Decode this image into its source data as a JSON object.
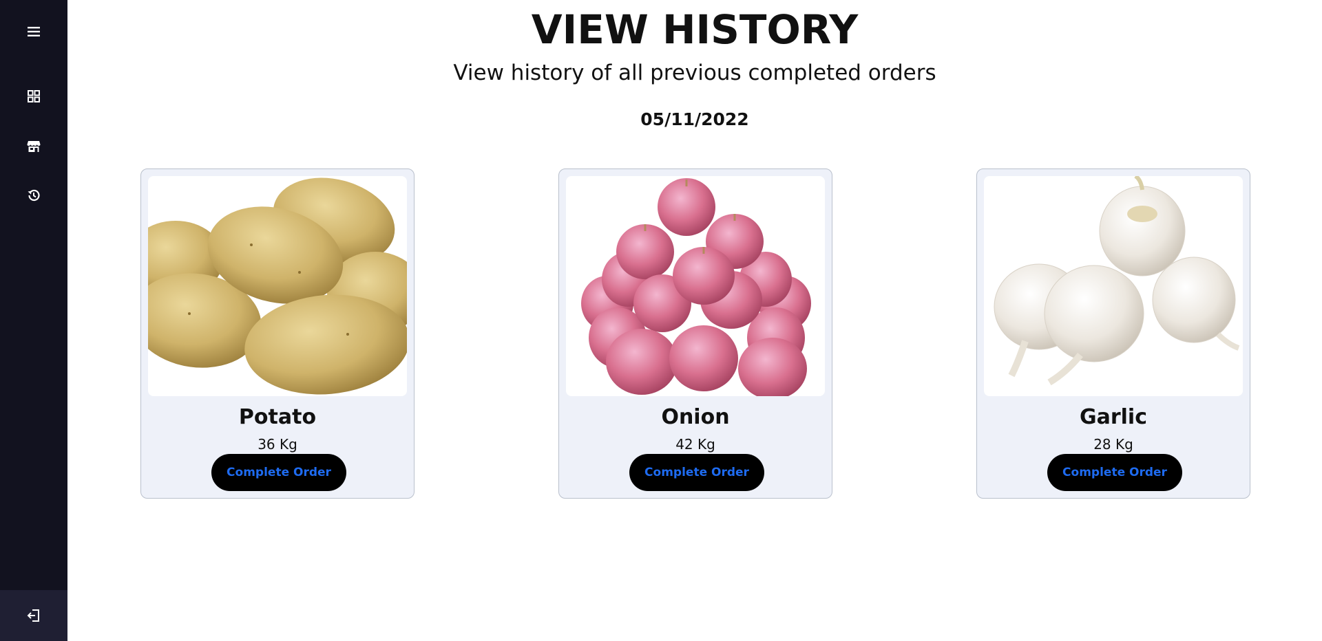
{
  "sidebar": {
    "items": [
      {
        "icon": "menu-icon"
      },
      {
        "icon": "dashboard-grid-icon"
      },
      {
        "icon": "store-icon"
      },
      {
        "icon": "history-icon"
      }
    ],
    "logout_icon": "logout-icon",
    "colors": {
      "background": "#12121f",
      "logout_background": "#1f1f33",
      "icon": "#ffffff"
    }
  },
  "header": {
    "title": "VIEW HISTORY",
    "subtitle": "View history of all previous completed orders",
    "date": "05/11/2022"
  },
  "orders": [
    {
      "name": "Potato",
      "quantity": "36 Kg",
      "button_label": "Complete Order",
      "image": "potatoes"
    },
    {
      "name": "Onion",
      "quantity": "42 Kg",
      "button_label": "Complete Order",
      "image": "red-onions"
    },
    {
      "name": "Garlic",
      "quantity": "28 Kg",
      "button_label": "Complete Order",
      "image": "garlic-bulbs"
    }
  ],
  "colors": {
    "card_background": "#eef1f9",
    "button_background": "#000000",
    "button_text": "#1e6bf0"
  }
}
